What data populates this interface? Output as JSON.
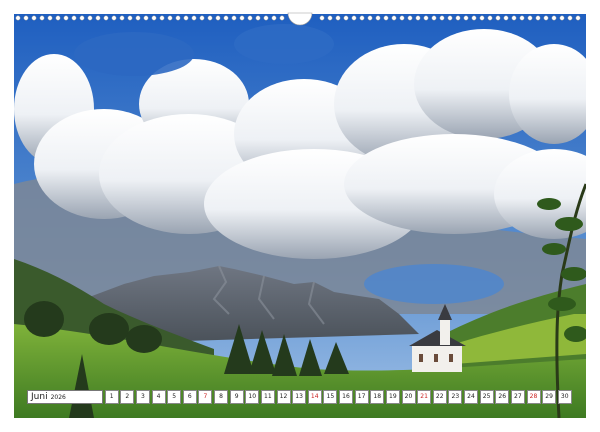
{
  "calendar": {
    "month": "Juni",
    "year": "2026",
    "days": [
      {
        "d": "1"
      },
      {
        "d": "2"
      },
      {
        "d": "3"
      },
      {
        "d": "4"
      },
      {
        "d": "5"
      },
      {
        "d": "6"
      },
      {
        "d": "7",
        "hol": true
      },
      {
        "d": "8"
      },
      {
        "d": "9"
      },
      {
        "d": "10"
      },
      {
        "d": "11"
      },
      {
        "d": "12"
      },
      {
        "d": "13"
      },
      {
        "d": "14",
        "hol": true
      },
      {
        "d": "15"
      },
      {
        "d": "16"
      },
      {
        "d": "17"
      },
      {
        "d": "18"
      },
      {
        "d": "19"
      },
      {
        "d": "20"
      },
      {
        "d": "21",
        "hol": true
      },
      {
        "d": "22"
      },
      {
        "d": "23"
      },
      {
        "d": "24"
      },
      {
        "d": "25"
      },
      {
        "d": "26"
      },
      {
        "d": "27"
      },
      {
        "d": "28",
        "hol": true
      },
      {
        "d": "29"
      },
      {
        "d": "30"
      }
    ]
  },
  "colors": {
    "sky": "#2f6fc4",
    "meadow": "#5a9a2e",
    "holiday": "#cc2222"
  }
}
